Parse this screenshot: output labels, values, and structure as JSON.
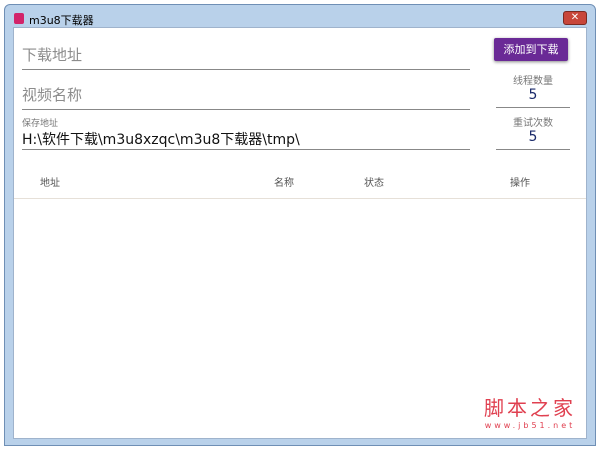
{
  "window": {
    "title": "m3u8下载器",
    "close": "✕"
  },
  "form": {
    "url_placeholder": "下载地址",
    "name_placeholder": "视频名称",
    "save_label": "保存地址",
    "save_value": "H:\\软件下载\\m3u8xzqc\\m3u8下载器\\tmp\\"
  },
  "add_button": "添加到下载",
  "threads": {
    "label": "线程数量",
    "value": "5"
  },
  "retries": {
    "label": "重试次数",
    "value": "5"
  },
  "table": {
    "headers": [
      "地址",
      "名称",
      "状态",
      "操作"
    ]
  },
  "watermark": {
    "name": "脚本之家",
    "url": "www.jb51.net"
  }
}
